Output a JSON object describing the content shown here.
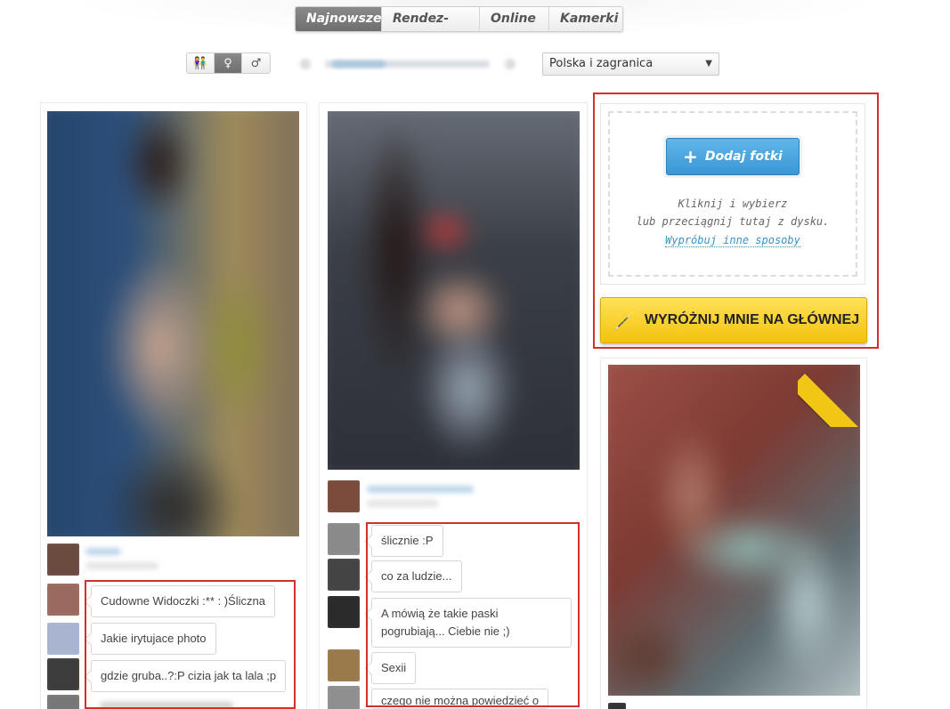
{
  "tabs": [
    "Najnowsze",
    "Rendez-vous",
    "Online",
    "Kamerki"
  ],
  "active_tab": "Najnowsze",
  "gender_filter": {
    "options": [
      "couple-icon",
      "female-icon",
      "male-icon"
    ],
    "active": "female-icon",
    "glyphs": [
      "👫",
      "♀",
      "♂"
    ]
  },
  "location_select": {
    "value": "Polska i zagranica",
    "arrow": "▼"
  },
  "upload": {
    "button_label": "Dodaj fotki",
    "plus": "+",
    "hint_line1": "Kliknij i wybierz",
    "hint_line2": "lub przeciągnij tutaj z dysku.",
    "link": "Wypróbuj inne sposoby"
  },
  "feature_button": {
    "label": "WYRÓŻNIJ MNIE NA GŁÓWNEJ",
    "icon": "magic-wand-icon",
    "glyph": "🪄"
  },
  "column1_comments": [
    "Cudowne Widoczki :** : )Śliczna",
    "Jakie irytujace photo",
    "gdzie gruba..?:P cizia jak ta lala ;p"
  ],
  "column2_comments": [
    "ślicznie :P",
    "co za ludzie...",
    "A mówią że takie paski pogrubiają... Ciebie nie ;)",
    "Sexii",
    "czego nie można powiedzieć o"
  ],
  "colors": {
    "highlight_red": "#d32f2f",
    "accent_blue": "#3a97d5",
    "feature_yellow": "#f3c20f"
  }
}
